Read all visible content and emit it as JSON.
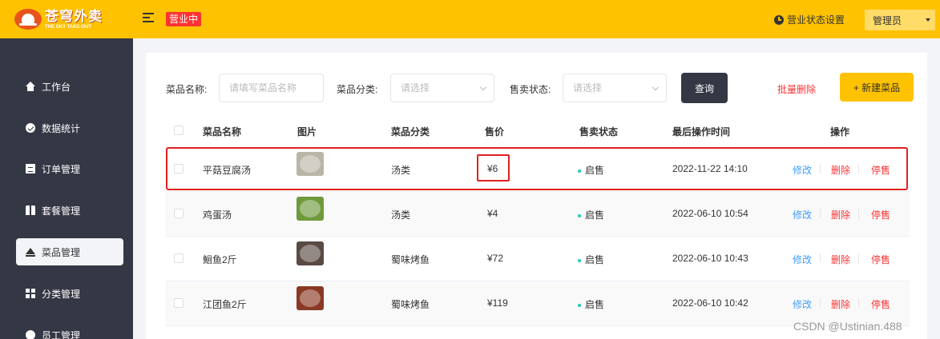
{
  "header": {
    "logo_text": "苍穹外卖",
    "logo_subtext": "THE SKY TAKE-OUT",
    "status_tag": "营业中",
    "settings_label": "营业状态设置",
    "user_label": "管理员"
  },
  "sidebar": {
    "items": [
      {
        "label": "工作台",
        "icon": "home-icon"
      },
      {
        "label": "数据统计",
        "icon": "chart-icon"
      },
      {
        "label": "订单管理",
        "icon": "order-icon"
      },
      {
        "label": "套餐管理",
        "icon": "combo-icon"
      },
      {
        "label": "菜品管理",
        "icon": "dish-icon",
        "active": true
      },
      {
        "label": "分类管理",
        "icon": "category-icon"
      },
      {
        "label": "员工管理",
        "icon": "employee-icon"
      }
    ]
  },
  "filters": {
    "name_label": "菜品名称:",
    "name_placeholder": "请填写菜品名称",
    "category_label": "菜品分类:",
    "category_placeholder": "请选择",
    "status_label": "售卖状态:",
    "status_placeholder": "请选择",
    "query_button": "查询",
    "bulk_delete": "批量删除",
    "new_button": "+ 新建菜品"
  },
  "table": {
    "columns": [
      "菜品名称",
      "图片",
      "菜品分类",
      "售价",
      "售卖状态",
      "最后操作时间",
      "操作"
    ],
    "rows": [
      {
        "name": "平菇豆腐汤",
        "category": "汤类",
        "price": "¥6",
        "status": "启售",
        "time": "2022-11-22 14:10",
        "thumb_color": "#b9b6a8"
      },
      {
        "name": "鸡蛋汤",
        "category": "汤类",
        "price": "¥4",
        "status": "启售",
        "time": "2022-06-10 10:54",
        "thumb_color": "#6f9a3c"
      },
      {
        "name": "鮰鱼2斤",
        "category": "蜀味烤鱼",
        "price": "¥72",
        "status": "启售",
        "time": "2022-06-10 10:43",
        "thumb_color": "#5a4a44"
      },
      {
        "name": "江团鱼2斤",
        "category": "蜀味烤鱼",
        "price": "¥119",
        "status": "启售",
        "time": "2022-06-10 10:42",
        "thumb_color": "#8a3a24"
      }
    ],
    "actions": {
      "edit": "修改",
      "delete": "删除",
      "stop": "停售"
    }
  },
  "watermark": "CSDN @Ustinian.488",
  "colors": {
    "brand": "#ffc200",
    "sidebar": "#343744",
    "danger": "#fd3333",
    "link": "#419eff",
    "status_dot": "#22ccb2",
    "highlight": "#e02020"
  }
}
